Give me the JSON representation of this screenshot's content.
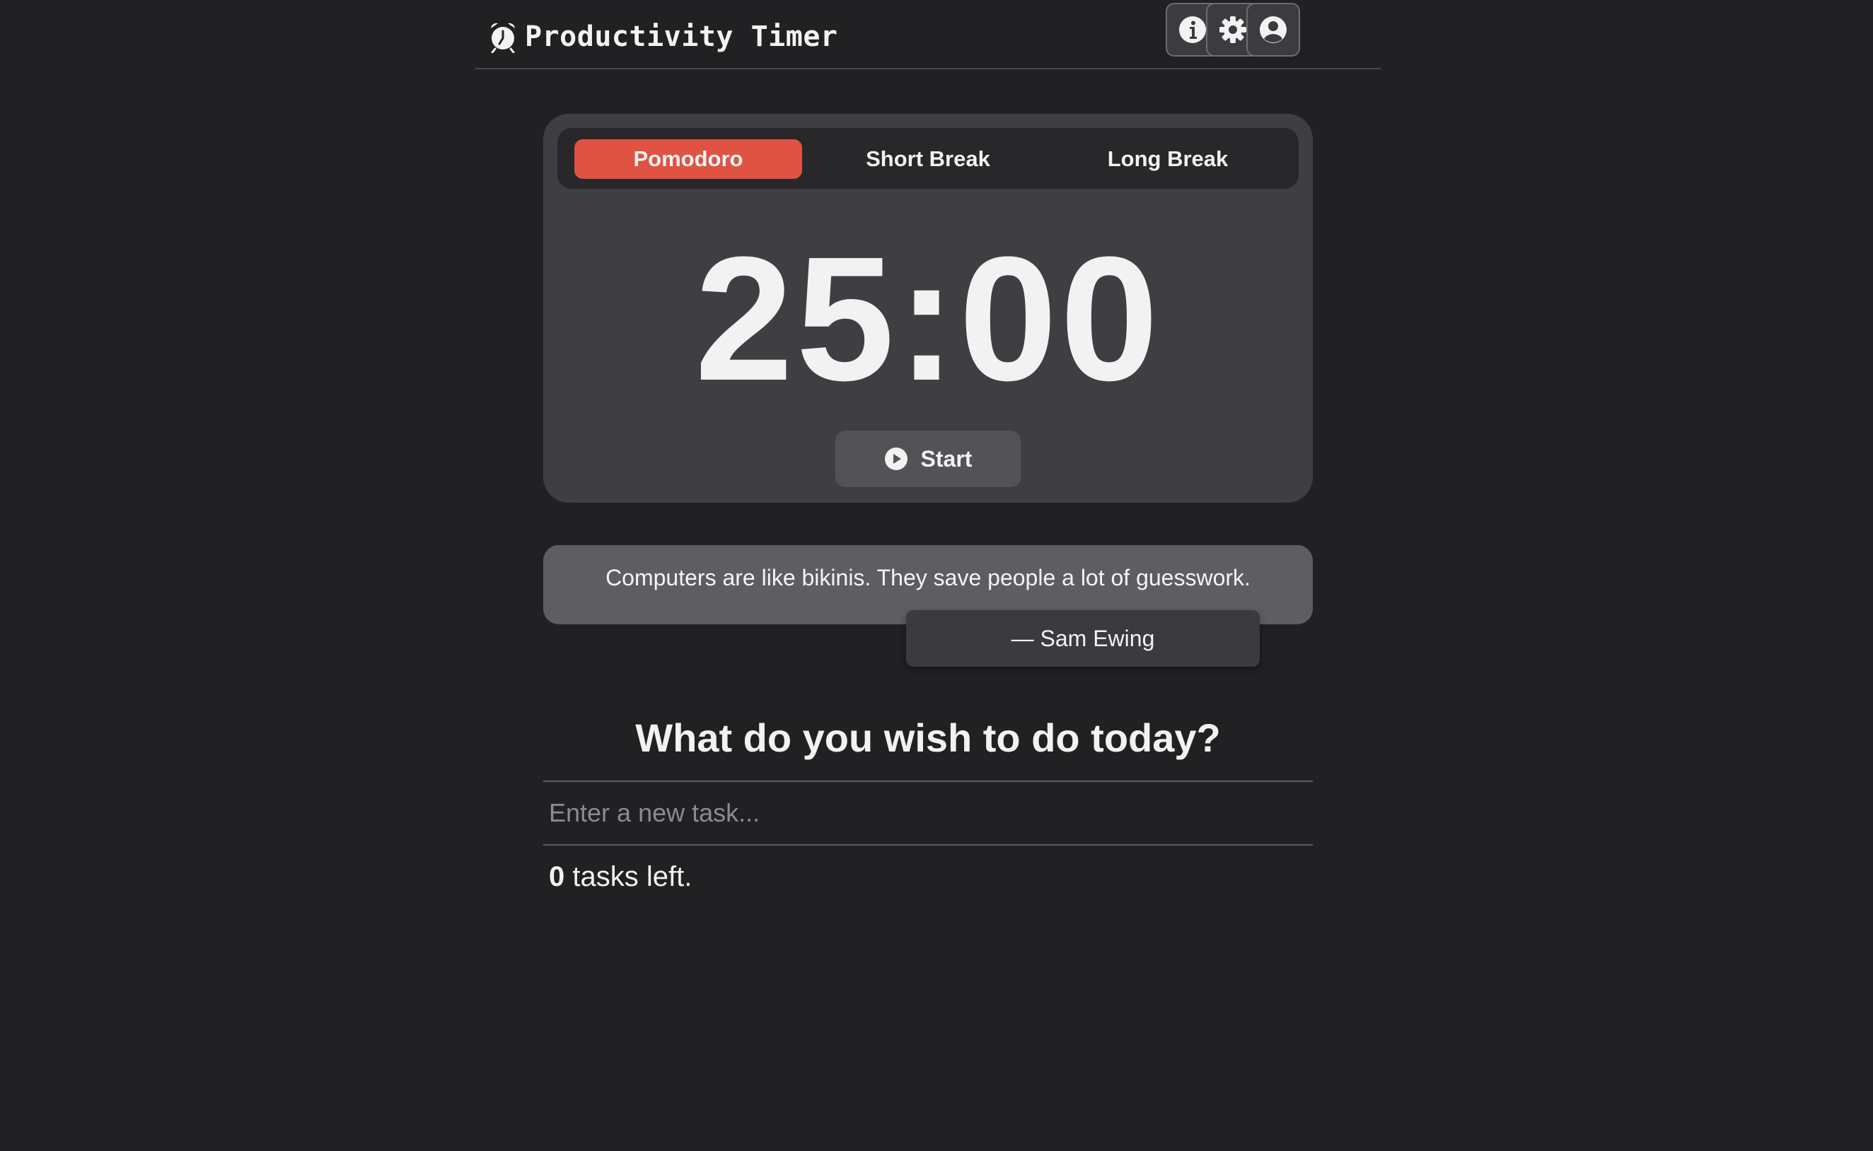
{
  "header": {
    "title": "Productivity Timer",
    "brand_icon": "alarm-clock-icon",
    "buttons": [
      {
        "icon": "info-icon"
      },
      {
        "icon": "gear-icon"
      },
      {
        "icon": "user-circle-icon"
      }
    ]
  },
  "timer": {
    "tabs": [
      {
        "label": "Pomodoro",
        "active": true
      },
      {
        "label": "Short Break",
        "active": false
      },
      {
        "label": "Long Break",
        "active": false
      }
    ],
    "time": "25:00",
    "start_label": "Start",
    "start_icon": "play-circle-icon",
    "accent_color": "#e05242"
  },
  "quote": {
    "text": "Computers are like bikinis. They save people a lot of guesswork.",
    "author": "— Sam Ewing"
  },
  "tasks": {
    "heading": "What do you wish to do today?",
    "input_placeholder": "Enter a new task...",
    "input_value": "",
    "count": "0",
    "count_suffix": " tasks left."
  }
}
